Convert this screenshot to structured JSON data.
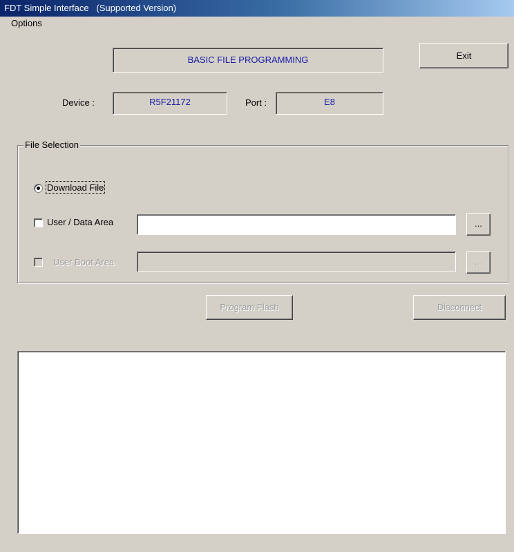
{
  "window": {
    "title": "FDT Simple Interface   (Supported Version)"
  },
  "menu": {
    "options": "Options"
  },
  "header": {
    "mode": "BASIC FILE PROGRAMMING",
    "exit_label": "Exit"
  },
  "device": {
    "label": "Device :",
    "value": "R5F21172"
  },
  "port": {
    "label": "Port :",
    "value": "E8"
  },
  "file_selection": {
    "title": "File Selection",
    "download_file": {
      "label": "Download File",
      "selected": true
    },
    "user_data_area": {
      "label": "User / Data Area",
      "checked": false,
      "value": "",
      "browse_label": "..."
    },
    "user_boot_area": {
      "label": "User Boot Area",
      "checked": false,
      "enabled": false,
      "value": "",
      "browse_label": "..."
    }
  },
  "actions": {
    "program_flash": "Program Flash",
    "disconnect": "Disconnect"
  },
  "log": {
    "text": ""
  }
}
